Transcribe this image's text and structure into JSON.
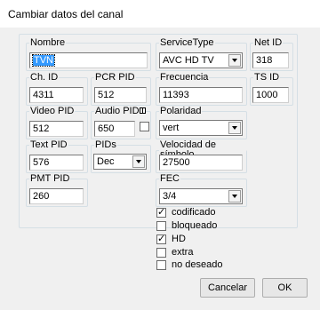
{
  "window": {
    "title": "Cambiar datos del canal"
  },
  "groups": {
    "nombre": {
      "label": "Nombre",
      "value": "TVN"
    },
    "servicetype": {
      "label": "ServiceType",
      "value": "AVC HD TV"
    },
    "netid": {
      "label": "Net ID",
      "value": "318"
    },
    "chid": {
      "label": "Ch. ID",
      "value": "4311"
    },
    "pcrpid": {
      "label": "PCR PID",
      "value": "512"
    },
    "frecuencia": {
      "label": "Frecuencia",
      "value": "11393"
    },
    "tsid": {
      "label": "TS ID",
      "value": "1000"
    },
    "videopid": {
      "label": "Video PID",
      "value": "512"
    },
    "audiopid": {
      "label": "Audio PID",
      "value": "650"
    },
    "polaridad": {
      "label": "Polaridad",
      "value": "vert"
    },
    "textpid": {
      "label": "Text PID",
      "value": "576"
    },
    "pids": {
      "label": "PIDs",
      "value": "Dec"
    },
    "velocidad": {
      "label": "Velocidad de símbolo",
      "value": "27500"
    },
    "pmtpid": {
      "label": "PMT PID",
      "value": "260"
    },
    "fec": {
      "label": "FEC",
      "value": "3/4"
    }
  },
  "checkboxes": [
    {
      "label": "codificado",
      "checked": true
    },
    {
      "label": "bloqueado",
      "checked": false
    },
    {
      "label": "HD",
      "checked": true
    },
    {
      "label": "extra",
      "checked": false
    },
    {
      "label": "no deseado",
      "checked": false
    }
  ],
  "buttons": {
    "cancel": "Cancelar",
    "ok": "OK"
  }
}
